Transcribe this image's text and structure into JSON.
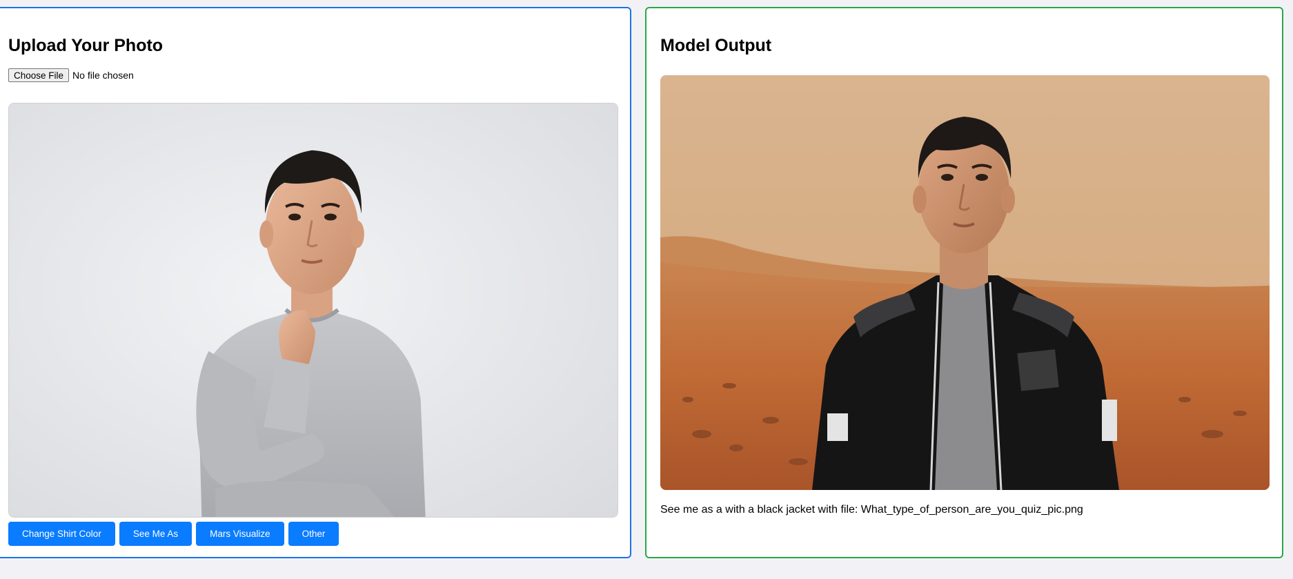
{
  "upload_panel": {
    "title": "Upload Your Photo",
    "file_button_label": "Choose File",
    "file_status": "No file chosen",
    "photo_alt": "Man in grey sweater thinking",
    "buttons": [
      {
        "label": "Change Shirt Color"
      },
      {
        "label": "See Me As"
      },
      {
        "label": "Mars Visualize"
      },
      {
        "label": "Other"
      }
    ]
  },
  "output_panel": {
    "title": "Model Output",
    "photo_alt": "Man in black jacket on Mars desert",
    "caption": "See me as a with a black jacket with file: What_type_of_person_are_you_quiz_pic.png"
  },
  "colors": {
    "upload_border": "#1a73e8",
    "output_border": "#28a745",
    "button_bg": "#0a7cff",
    "page_bg": "#f2f2f6"
  }
}
